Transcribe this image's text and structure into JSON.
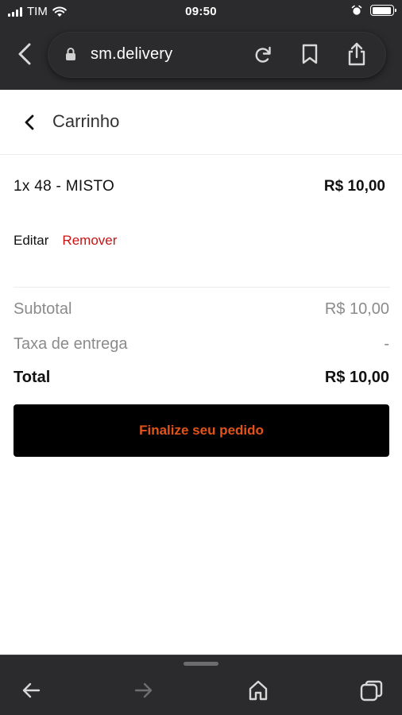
{
  "status_bar": {
    "carrier": "TIM",
    "time": "09:50",
    "battery_level": 0.95
  },
  "browser": {
    "url": "sm.delivery",
    "icons": {
      "back": "chevron-left-icon",
      "lock": "lock-icon",
      "reload": "reload-icon",
      "bookmark": "bookmark-icon",
      "share": "share-icon"
    }
  },
  "header": {
    "title": "Carrinho"
  },
  "cart": {
    "item": {
      "name": "1x 48 - MISTO",
      "price": "R$ 10,00"
    },
    "actions": {
      "edit": "Editar",
      "remove": "Remover"
    },
    "summary": {
      "subtotal_label": "Subtotal",
      "subtotal_value": "R$ 10,00",
      "delivery_label": "Taxa de entrega",
      "delivery_value": "-",
      "total_label": "Total",
      "total_value": "R$ 10,00"
    },
    "checkout_label": "Finalize seu pedido"
  },
  "toolbar": {
    "icons": [
      "back-arrow-icon",
      "forward-arrow-icon",
      "home-icon",
      "tabs-icon"
    ]
  },
  "colors": {
    "accent": "#e2541a",
    "remove": "#c81414",
    "browser_chrome": "#2b2b2d"
  }
}
